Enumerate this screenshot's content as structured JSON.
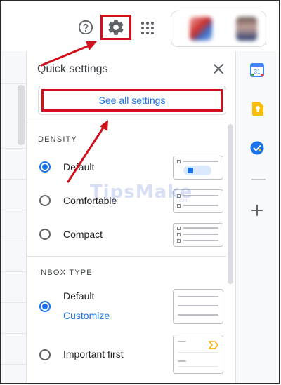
{
  "topbar": {
    "help_icon": "help-circle-icon",
    "settings_icon": "gear-icon",
    "apps_icon": "apps-grid-icon",
    "account_card": "blurred-account-avatars"
  },
  "quick_settings": {
    "title": "Quick settings",
    "close_icon": "close-icon",
    "see_all_label": "See all settings",
    "density": {
      "label": "DENSITY",
      "options": [
        {
          "label": "Default",
          "checked": true
        },
        {
          "label": "Comfortable",
          "checked": false
        },
        {
          "label": "Compact",
          "checked": false
        }
      ]
    },
    "inbox_type": {
      "label": "INBOX TYPE",
      "options": [
        {
          "label": "Default",
          "checked": true,
          "link": "Customize"
        },
        {
          "label": "Important first",
          "checked": false
        }
      ]
    }
  },
  "side_panel": {
    "icons": [
      "calendar-icon",
      "keep-icon",
      "tasks-icon",
      "add-icon"
    ],
    "calendar_day": "31"
  },
  "watermark": {
    "text": "TipsMake",
    "sub": ".com"
  },
  "colors": {
    "accent": "#1a73e8",
    "highlight": "#d0101a"
  }
}
